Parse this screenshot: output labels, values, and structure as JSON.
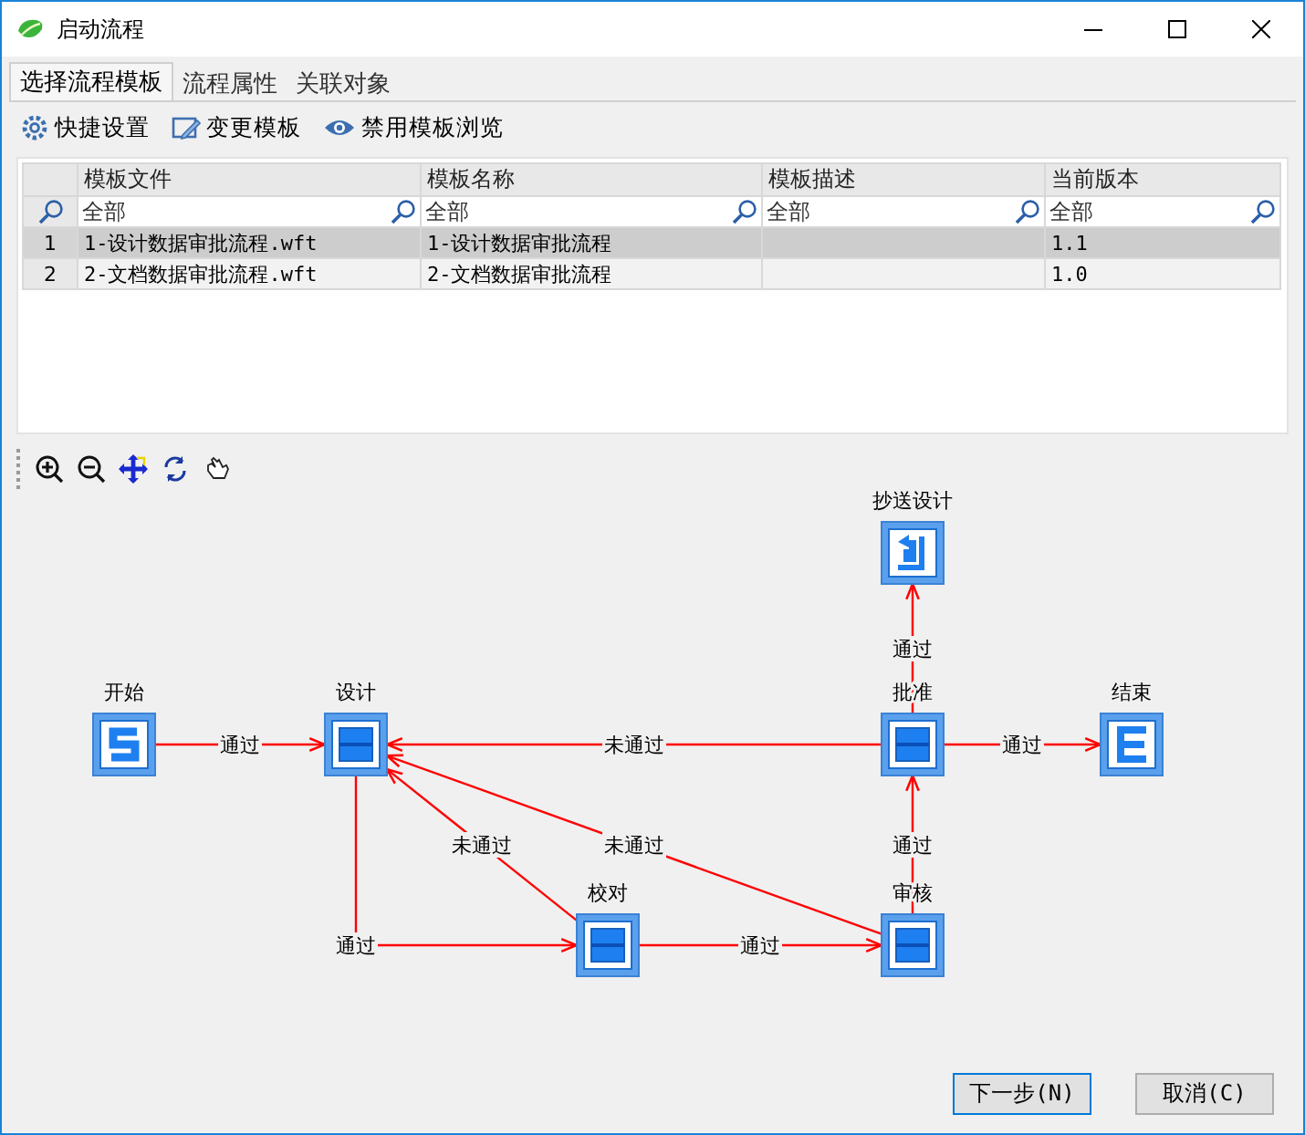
{
  "window": {
    "title": "启动流程"
  },
  "tabs": [
    {
      "label": "选择流程模板",
      "selected": true
    },
    {
      "label": "流程属性",
      "selected": false
    },
    {
      "label": "关联对象",
      "selected": false
    }
  ],
  "toolbar": [
    {
      "kind": "gear",
      "label": "快捷设置"
    },
    {
      "kind": "edit",
      "label": "变更模板"
    },
    {
      "kind": "eye",
      "label": "禁用模板浏览"
    }
  ],
  "table": {
    "columns": [
      "模板文件",
      "模板名称",
      "模板描述",
      "当前版本"
    ],
    "filters": [
      "全部",
      "全部",
      "全部",
      "全部"
    ],
    "rows": [
      {
        "number": "1",
        "selected": true,
        "cells": [
          "1-设计数据审批流程.wft",
          "1-设计数据审批流程",
          null,
          "1.1"
        ]
      },
      {
        "number": "2",
        "selected": false,
        "cells": [
          "2-文档数据审批流程.wft",
          "2-文档数据审批流程",
          null,
          "1.0"
        ]
      }
    ]
  },
  "diagram_tools": [
    {
      "kind": "zoom-in"
    },
    {
      "kind": "zoom-out"
    },
    {
      "kind": "move"
    },
    {
      "kind": "refresh"
    },
    {
      "kind": "hand"
    }
  ],
  "diagram": {
    "nodes": [
      {
        "label": "开始",
        "kind": "start"
      },
      {
        "label": "设计",
        "kind": "task"
      },
      {
        "label": "抄送设计",
        "kind": "cc"
      },
      {
        "label": "批准",
        "kind": "task"
      },
      {
        "label": "结束",
        "kind": "end"
      },
      {
        "label": "校对",
        "kind": "task"
      },
      {
        "label": "审核",
        "kind": "task"
      }
    ],
    "edges": [
      {
        "label": "通过",
        "kind": "straight"
      },
      {
        "label": "通过",
        "kind": "straight"
      },
      {
        "label": "未通过",
        "kind": "straight"
      },
      {
        "label": "通过",
        "kind": "straight"
      },
      {
        "label": "未通过",
        "kind": "straight"
      },
      {
        "label": "未通过",
        "kind": "straight"
      },
      {
        "label": "通过",
        "kind": "straight"
      },
      {
        "label": "通过",
        "kind": "elbow"
      },
      {
        "label": "通过",
        "kind": "straight"
      }
    ]
  },
  "buttons": [
    {
      "label": "下一步(N)",
      "default": true
    },
    {
      "label": "取消(C)",
      "default": false
    }
  ]
}
